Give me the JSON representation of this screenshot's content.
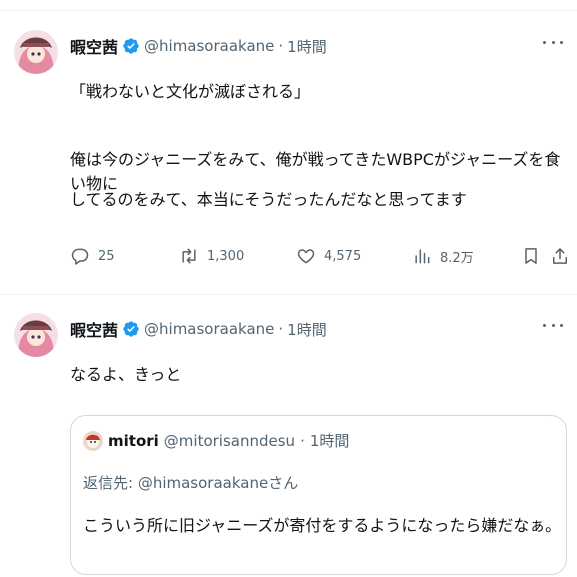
{
  "tweets": [
    {
      "author": {
        "display_name": "暇空茜",
        "handle": "@himasoraakane",
        "time": "1時間",
        "separator": "·"
      },
      "text_line1": "「戦わないと文化が滅ぼされる」",
      "text_line2": "俺は今のジャニーズをみて、俺が戦ってきたWBPCがジャニーズを食い物に",
      "text_line3": "してるのをみて、本当にそうだったんだなと思ってます",
      "actions": {
        "replies": "25",
        "retweets": "1,300",
        "likes": "4,575",
        "views": "8.2万"
      }
    },
    {
      "author": {
        "display_name": "暇空茜",
        "handle": "@himasoraakane",
        "time": "1時間",
        "separator": "·"
      },
      "text_line1": "なるよ、きっと",
      "quote": {
        "display_name": "mitori",
        "handle": "@mitorisanndesu",
        "separator": "·",
        "time": "1時間",
        "replying_prefix": "返信先: ",
        "replying_handle": "@himasoraakane",
        "replying_suffix": "さん",
        "text": "こういう所に旧ジャニーズが寄付をするようになったら嫌だなぁ。"
      }
    }
  ],
  "colors": {
    "accent": "#1d9bf0",
    "muted": "#536471",
    "text": "#0f1419",
    "border": "#cfd9de"
  },
  "icons": [
    "verified-badge-icon",
    "more-icon",
    "reply-icon",
    "retweet-icon",
    "like-icon",
    "views-icon",
    "bookmark-icon",
    "share-icon"
  ]
}
